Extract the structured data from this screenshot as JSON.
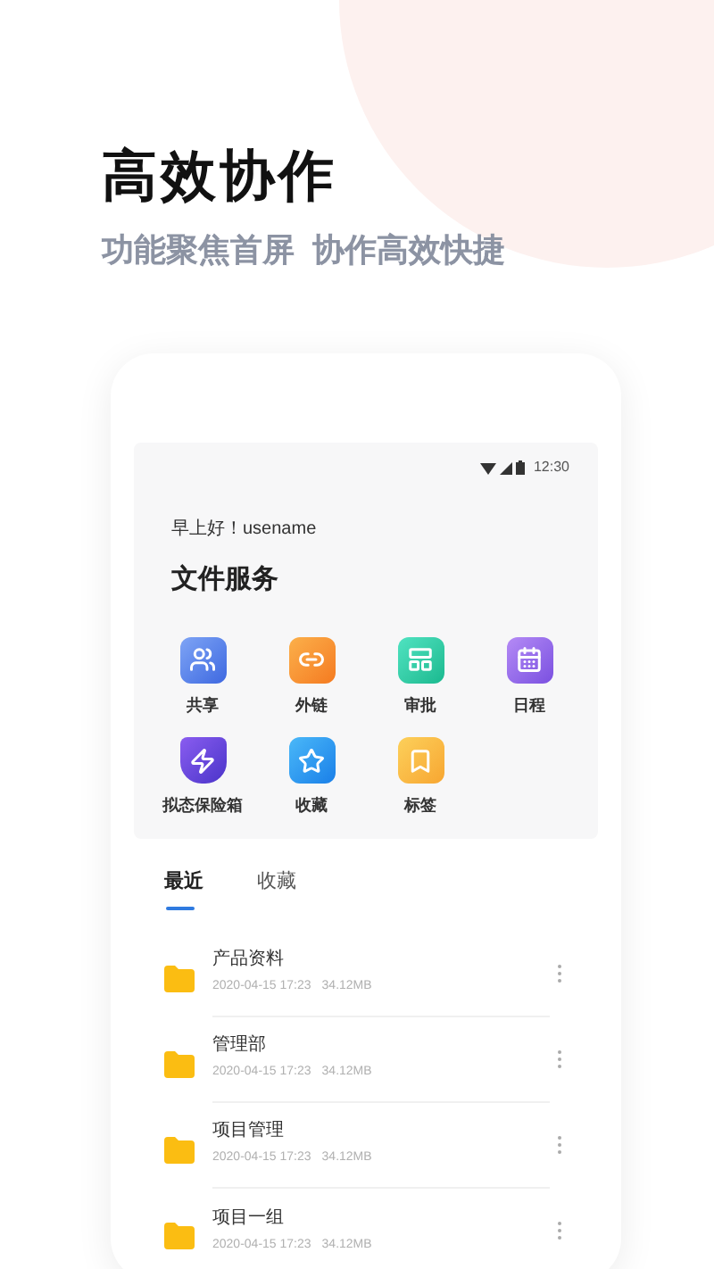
{
  "headline": "高效协作",
  "tagline": [
    "功能聚焦首屏",
    "协作高效快捷"
  ],
  "phone": {
    "status_bar": {
      "time": "12:30"
    },
    "greeting": "早上好！usename",
    "section_title": "文件服务",
    "services": [
      {
        "label": "共享",
        "kind": "share"
      },
      {
        "label": "外链",
        "kind": "link"
      },
      {
        "label": "审批",
        "kind": "approval"
      },
      {
        "label": "日程",
        "kind": "calendar"
      },
      {
        "label": "拟态保险箱",
        "kind": "safe"
      },
      {
        "label": "收藏",
        "kind": "favorite"
      },
      {
        "label": "标签",
        "kind": "tag"
      }
    ],
    "tabs": [
      {
        "label": "最近",
        "selected": true
      },
      {
        "label": "收藏",
        "selected": false
      }
    ],
    "files": [
      {
        "name": "产品资料",
        "date": "2020-04-15 17:23",
        "size": "34.12MB"
      },
      {
        "name": "管理部",
        "date": "2020-04-15 17:23",
        "size": "34.12MB"
      },
      {
        "name": "项目管理",
        "date": "2020-04-15 17:23",
        "size": "34.12MB"
      },
      {
        "name": "项目一组",
        "date": "2020-04-15 17:23",
        "size": "34.12MB"
      }
    ]
  }
}
